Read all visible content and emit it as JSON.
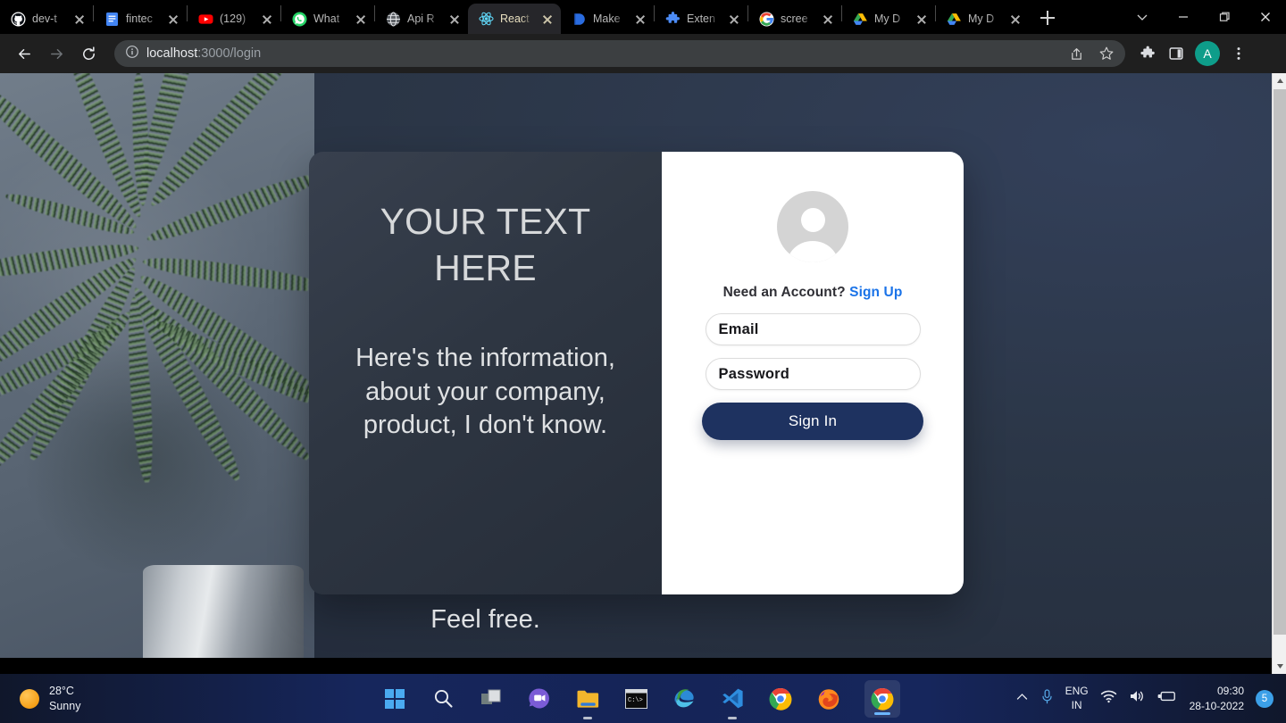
{
  "browser": {
    "tabs": [
      {
        "title": "dev-t",
        "icon": "github-icon",
        "active": false
      },
      {
        "title": "fintec",
        "icon": "google-docs-icon",
        "active": false
      },
      {
        "title": "(129)",
        "icon": "youtube-icon",
        "active": false
      },
      {
        "title": "What",
        "icon": "whatsapp-icon",
        "active": false
      },
      {
        "title": "Api R",
        "icon": "globe-icon",
        "active": false
      },
      {
        "title": "React",
        "icon": "react-icon",
        "active": true
      },
      {
        "title": "Make",
        "icon": "make-icon",
        "active": false
      },
      {
        "title": "Exten",
        "icon": "extension-icon",
        "active": false
      },
      {
        "title": "scree",
        "icon": "google-icon",
        "active": false
      },
      {
        "title": "My D",
        "icon": "google-drive-icon",
        "active": false
      },
      {
        "title": "My D",
        "icon": "google-drive-icon",
        "active": false
      }
    ],
    "new_tab_label": "New tab",
    "window_controls": [
      "tab-search-chevron",
      "minimize",
      "maximize",
      "close"
    ],
    "toolbar": {
      "back": "Back",
      "forward": "Forward",
      "reload": "Reload",
      "site_info": "site-info-icon",
      "url_host": "localhost",
      "url_path": ":3000/login",
      "share": "Share",
      "bookmark": "Bookmark this tab",
      "extensions": "Extensions",
      "side_panel": "Side panel",
      "profile_initial": "A",
      "menu": "Customize and control Google Chrome"
    }
  },
  "page": {
    "heading": "YOUR TEXT HERE",
    "body": "Here's the information, about your company, product, I don't know.",
    "footer": "Feel free.",
    "form": {
      "avatar": "user-avatar-placeholder",
      "need_account_text": "Need an Account?",
      "sign_up_link": "Sign Up",
      "email_placeholder": "Email",
      "email_value": "",
      "password_placeholder": "Password",
      "password_value": "",
      "sign_in_button": "Sign In"
    },
    "colors": {
      "panel_dark": "#2e3642",
      "button_navy": "#1e3260",
      "link_blue": "#1a73e8",
      "page_bg": "#2b3647"
    }
  },
  "taskbar": {
    "weather": {
      "temperature": "28°C",
      "condition": "Sunny"
    },
    "apps": [
      {
        "name": "start-button",
        "icon": "windows-icon",
        "state": "idle"
      },
      {
        "name": "search-button",
        "icon": "search-icon",
        "state": "idle"
      },
      {
        "name": "task-view",
        "icon": "task-view-icon",
        "state": "idle"
      },
      {
        "name": "chat-teams",
        "icon": "chat-icon",
        "state": "idle"
      },
      {
        "name": "file-explorer",
        "icon": "folder-icon",
        "state": "running"
      },
      {
        "name": "terminal",
        "icon": "terminal-icon",
        "state": "idle"
      },
      {
        "name": "microsoft-edge",
        "icon": "edge-icon",
        "state": "idle"
      },
      {
        "name": "vs-code",
        "icon": "vscode-icon",
        "state": "running"
      },
      {
        "name": "google-chrome",
        "icon": "chrome-icon",
        "state": "idle"
      },
      {
        "name": "firefox",
        "icon": "firefox-icon",
        "state": "idle"
      },
      {
        "name": "chrome-active",
        "icon": "chrome-icon",
        "state": "active"
      }
    ],
    "tray": {
      "overflow": "show-hidden-icons",
      "microphone": "microphone-icon",
      "language_primary": "ENG",
      "language_secondary": "IN",
      "wifi": "wifi-icon",
      "volume": "volume-icon",
      "battery": "battery-charging-icon",
      "time": "09:30",
      "date": "28-10-2022",
      "notification_count": "5"
    }
  }
}
